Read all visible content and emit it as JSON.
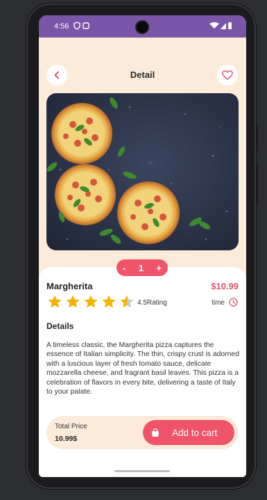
{
  "status_bar": {
    "time": "4:56"
  },
  "header": {
    "title": "Detail"
  },
  "product": {
    "name": "Margherita",
    "price": "$10.99",
    "quantity": "1",
    "rating_value": 4.5,
    "rating_label": "4.5Rating",
    "time_label": "time",
    "details_heading": "Details",
    "description": "A timeless classic, the Margherita pizza captures the essence of Italian simplicity. The thin, crispy crust is adorned with a luscious layer of fresh tomato sauce, delicate mozzarella cheese, and fragrant basil leaves. This pizza is a celebration of flavors in every bite, delivering a taste of Italy to your palate."
  },
  "stepper": {
    "minus": "-",
    "plus": "+"
  },
  "footer": {
    "total_label": "Total Price",
    "total_value": "10.99$",
    "add_to_cart_label": "Add to cart"
  },
  "colors": {
    "accent": "#ef5468",
    "price": "#e0546a",
    "star": "#f5b400",
    "status_bar": "#7b55a7",
    "background": "#fdebd9"
  }
}
